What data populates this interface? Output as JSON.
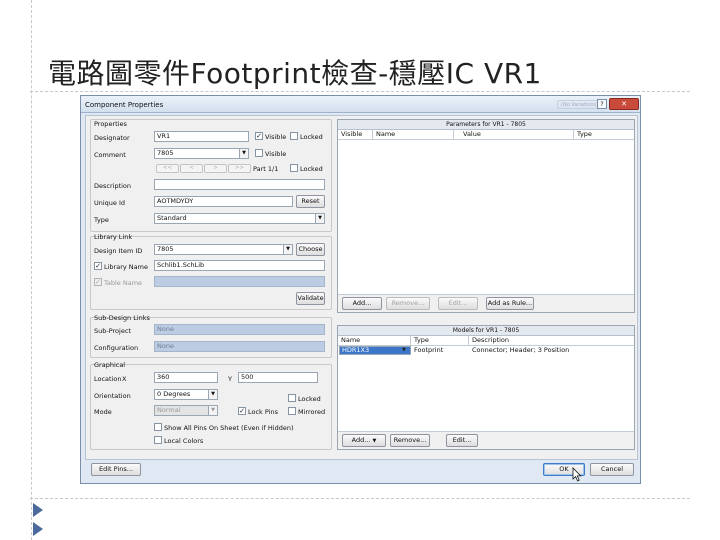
{
  "slide": {
    "title": "電路圖零件Footprint檢查-穩壓IC VR1"
  },
  "dialog": {
    "title": "Component Properties",
    "ghost_text": "(No Variations)",
    "help_label": "?",
    "close_label": "✕",
    "properties": {
      "section_label": "Properties",
      "designator_label": "Designator",
      "designator_value": "VR1",
      "designator_visible_label": "Visible",
      "designator_visible_checked": "✓",
      "designator_locked_label": "Locked",
      "comment_label": "Comment",
      "comment_value": "7805",
      "comment_visible_label": "Visible",
      "nav_first": "<<",
      "nav_prev": "<",
      "nav_next": ">",
      "nav_last": ">>",
      "part_label": "Part 1/1",
      "part_locked_label": "Locked",
      "description_label": "Description",
      "description_value": "",
      "unique_id_label": "Unique Id",
      "unique_id_value": "AOTMDYDY",
      "reset_label": "Reset",
      "type_label": "Type",
      "type_value": "Standard"
    },
    "library_link": {
      "section_label": "Library Link",
      "design_item_label": "Design Item ID",
      "design_item_value": "7805",
      "choose_label": "Choose",
      "library_name_label": "Library Name",
      "library_name_checked": "✓",
      "library_name_value": "Schlib1.SchLib",
      "table_name_label": "Table Name",
      "table_name_checked": "✓",
      "validate_label": "Validate"
    },
    "sub_design": {
      "section_label": "Sub-Design Links",
      "sub_project_label": "Sub-Project",
      "sub_project_value": "None",
      "configuration_label": "Configuration",
      "configuration_value": "None"
    },
    "graphical": {
      "section_label": "Graphical",
      "location_label": "Location",
      "x_label": "X",
      "x_value": "360",
      "y_label": "Y",
      "y_value": "500",
      "orientation_label": "Orientation",
      "orientation_value": "0 Degrees",
      "orientation_locked_label": "Locked",
      "mode_label": "Mode",
      "mode_value": "Normal",
      "lock_pins_label": "Lock Pins",
      "lock_pins_checked": "✓",
      "mirrored_label": "Mirrored",
      "show_all_pins_label": "Show All Pins On Sheet (Even if Hidden)",
      "local_colors_label": "Local Colors"
    },
    "parameters": {
      "title": "Parameters for VR1 - 7805",
      "columns": [
        "Visible",
        "Name",
        "Value",
        "Type"
      ],
      "add_label": "Add...",
      "remove_label": "Remove...",
      "edit_label": "Edit...",
      "add_as_rule_label": "Add as Rule..."
    },
    "models": {
      "title": "Models for VR1 - 7805",
      "columns": [
        "Name",
        "Type",
        "Description"
      ],
      "rows": [
        {
          "name": "HDR1X3",
          "type": "Footprint",
          "description": "Connector; Header; 3 Position"
        }
      ],
      "add_label": "Add...",
      "remove_label": "Remove...",
      "edit_label": "Edit..."
    },
    "footer": {
      "edit_pins_label": "Edit Pins...",
      "ok_label": "OK",
      "cancel_label": "Cancel"
    }
  }
}
